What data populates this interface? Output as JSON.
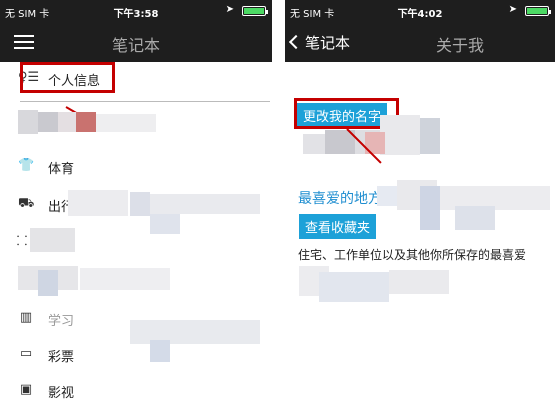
{
  "left_screen": {
    "status": {
      "carrier": "无 SIM 卡",
      "time": "下午3:58",
      "location_icon": "location-arrow-icon"
    },
    "nav": {
      "title": "笔记本",
      "menu_icon": "hamburger-menu-icon"
    },
    "profile_item": {
      "label": "个人信息",
      "icon": "person-list-icon"
    },
    "items": [
      {
        "label": "体育",
        "icon": "tshirt-icon"
      },
      {
        "label": "出行",
        "icon": "car-icon"
      },
      {
        "label": "",
        "icon": "ticket-icon"
      },
      {
        "label": "",
        "icon": "books-icon"
      },
      {
        "label": "彩票",
        "icon": "lottery-icon"
      },
      {
        "label": "影视",
        "icon": "film-icon"
      }
    ],
    "partial_labels": {
      "travel_fragment": "出行",
      "study_fragment": "学习"
    }
  },
  "right_screen": {
    "status": {
      "carrier": "无 SIM 卡",
      "time": "下午4:02",
      "location_icon": "location-arrow-icon"
    },
    "nav": {
      "back_label": "笔记本",
      "title": "关于我"
    },
    "change_name_button": "更改我的名字",
    "favorites_title": "最喜爱的地方",
    "view_favorites_button": "查看收藏夹",
    "favorites_desc": "住宅、工作单位以及其他你所保存的最喜爱"
  },
  "colors": {
    "bar": "#1e1e1e",
    "accent": "#1da1d8",
    "highlight": "#c40000",
    "battery": "#4cd964"
  }
}
